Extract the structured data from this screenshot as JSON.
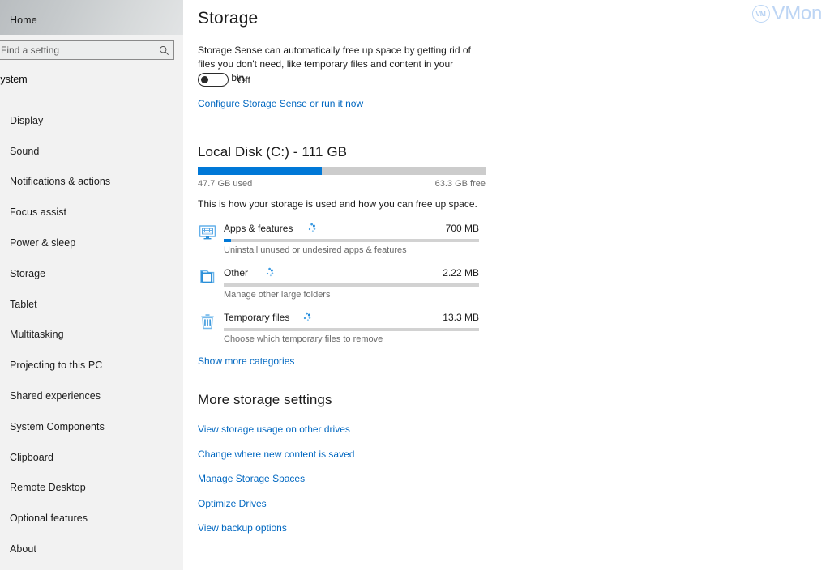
{
  "sidebar": {
    "home_label": "Home",
    "search": {
      "placeholder": "Find a setting",
      "value": "",
      "icon": "search-icon"
    },
    "group_label": "System",
    "items": [
      {
        "label": "Display",
        "selected": false
      },
      {
        "label": "Sound",
        "selected": false
      },
      {
        "label": "Notifications & actions",
        "selected": false
      },
      {
        "label": "Focus assist",
        "selected": false
      },
      {
        "label": "Power & sleep",
        "selected": false
      },
      {
        "label": "Storage",
        "selected": true
      },
      {
        "label": "Tablet",
        "selected": false
      },
      {
        "label": "Multitasking",
        "selected": false
      },
      {
        "label": "Projecting to this PC",
        "selected": false
      },
      {
        "label": "Shared experiences",
        "selected": false
      },
      {
        "label": "System Components",
        "selected": false
      },
      {
        "label": "Clipboard",
        "selected": false
      },
      {
        "label": "Remote Desktop",
        "selected": false
      },
      {
        "label": "Optional features",
        "selected": false
      },
      {
        "label": "About",
        "selected": false
      }
    ]
  },
  "main": {
    "page_title": "Storage",
    "storage_sense": {
      "description": "Storage Sense can automatically free up space by getting rid of files you don't need, like temporary files and content in your recycle bin.",
      "toggle_state": "Off",
      "toggle_on": false,
      "configure_link": "Configure Storage Sense or run it now"
    },
    "disk": {
      "title": "Local Disk (C:) - 111 GB",
      "used_label": "47.7 GB used",
      "free_label": "63.3 GB free",
      "used_percent": 43,
      "usage_description": "This is how your storage is used and how you can free up space."
    },
    "categories": [
      {
        "name": "Apps & features",
        "icon": "monitor-icon",
        "size": "700 MB",
        "bar_percent": 3,
        "subtitle": "Uninstall unused or undesired apps & features",
        "loading": true
      },
      {
        "name": "Other",
        "icon": "folder-icon",
        "size": "2.22 MB",
        "bar_percent": 0,
        "subtitle": "Manage other large folders",
        "loading": true
      },
      {
        "name": "Temporary files",
        "icon": "trash-icon",
        "size": "13.3 MB",
        "bar_percent": 0,
        "subtitle": "Choose which temporary files to remove",
        "loading": true
      }
    ],
    "show_more_label": "Show more categories",
    "more_settings": {
      "title": "More storage settings",
      "links": [
        "View storage usage on other drives",
        "Change where new content is saved",
        "Manage Storage Spaces",
        "Optimize Drives",
        "View backup options"
      ]
    }
  },
  "watermark": {
    "badge_text": "VM",
    "text": "VMon"
  },
  "colors": {
    "accent": "#0078D7",
    "link": "#0067C0",
    "track": "#CCCCCC",
    "sidebar_bg": "#F2F2F2"
  }
}
